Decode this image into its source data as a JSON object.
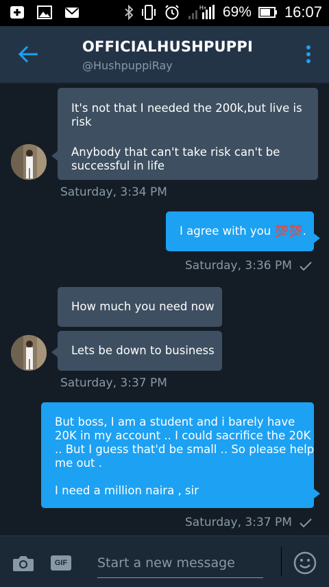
{
  "status_bar": {
    "battery_percent": "69%",
    "time": "16:07"
  },
  "header": {
    "title": "OFFICIALHUSHPUPPI",
    "handle": "@HushpuppiRay"
  },
  "messages": [
    {
      "direction": "in",
      "text": "It's not that I needed the 200k,but live is risk"
    },
    {
      "direction": "in",
      "text": "Anybody that can't take risk can't be successful in life"
    },
    {
      "direction": "in",
      "timestamp": "Saturday, 3:34 PM"
    },
    {
      "direction": "out",
      "text": "I agree with you 💯💯.",
      "timestamp": "Saturday, 3:36 PM",
      "read": true
    },
    {
      "direction": "in",
      "text": "How much you need now"
    },
    {
      "direction": "in",
      "text": "Lets be down to business",
      "timestamp": "Saturday, 3:37 PM"
    },
    {
      "direction": "out",
      "text_lines": [
        "But boss, I am a student and i barely have",
        "20K in my account .. I could sacrifice the 20K",
        ".. But I guess that'd be small .. So please help",
        "me out .",
        "",
        "I need a million naira , sir"
      ],
      "timestamp": "Saturday, 3:37 PM",
      "read": true
    }
  ],
  "composer": {
    "placeholder": "Start a new message",
    "gif_label": "GIF"
  },
  "colors": {
    "background": "#141d26",
    "header": "#243447",
    "incoming_bubble": "#3d4f60",
    "outgoing_bubble": "#1da1f2",
    "accent": "#1da1f2",
    "muted_text": "#8899a6"
  },
  "icons": [
    "add-icon",
    "image-icon",
    "mail-icon",
    "bluetooth-icon",
    "vibrate-icon",
    "alarm-icon",
    "signal-icon",
    "battery-icon",
    "back-arrow-icon",
    "more-vertical-icon",
    "camera-icon",
    "gif-icon",
    "emoji-icon",
    "checkmark-icon"
  ]
}
